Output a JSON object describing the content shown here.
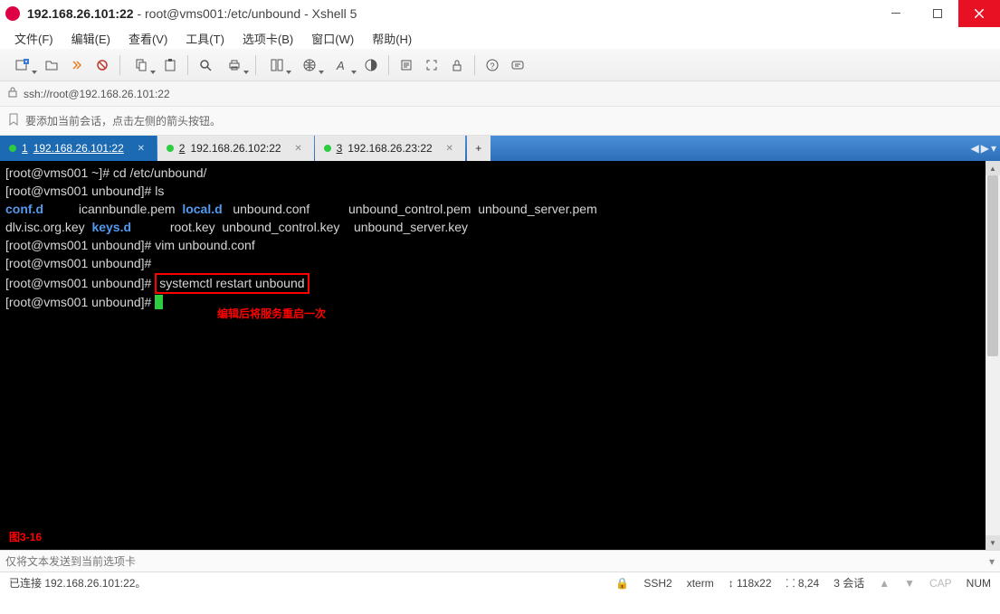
{
  "window": {
    "host": "192.168.26.101:22",
    "title_rest": " - root@vms001:/etc/unbound - Xshell 5"
  },
  "menu": [
    "文件(F)",
    "编辑(E)",
    "查看(V)",
    "工具(T)",
    "选项卡(B)",
    "窗口(W)",
    "帮助(H)"
  ],
  "address": {
    "url": "ssh://root@192.168.26.101:22"
  },
  "hint": "要添加当前会话，点击左侧的箭头按钮。",
  "tabs": [
    {
      "index": "1",
      "label": "192.168.26.101:22",
      "active": true
    },
    {
      "index": "2",
      "label": "192.168.26.102:22",
      "active": false
    },
    {
      "index": "3",
      "label": "192.168.26.23:22",
      "active": false
    }
  ],
  "terminal": {
    "l1_prompt": "[root@vms001 ~]#",
    "l1_cmd": " cd /etc/unbound/",
    "l2_prompt": "[root@vms001 unbound]#",
    "l2_cmd": " ls",
    "dir_conf": "conf.d",
    "l3a": "          icannbundle.pem  ",
    "dir_local": "local.d",
    "l3b": "   unbound.conf           unbound_control.pem  unbound_server.pem",
    "l4a": "dlv.isc.org.key  ",
    "dir_keys": "keys.d",
    "l4b": "           root.key  unbound_control.key    unbound_server.key",
    "l5_prompt": "[root@vms001 unbound]#",
    "l5_cmd": " vim unbound.conf",
    "l6_prompt": "[root@vms001 unbound]#",
    "l7_prompt": "[root@vms001 unbound]#",
    "l7_sp": " ",
    "l7_hl": "systemctl restart unbound",
    "l8_prompt": "[root@vms001 unbound]#",
    "l8_sp": " ",
    "annotation_restart": "编辑后将服务重启一次",
    "annotation_fig": "图3-16"
  },
  "sendbox": {
    "placeholder": "仅将文本发送到当前选项卡"
  },
  "status": {
    "left": "已连接 192.168.26.101:22。",
    "ssh": "SSH2",
    "term": "xterm",
    "size": "118x22",
    "cursor": "8,24",
    "sessions": "3 会话",
    "cap": "CAP",
    "num": "NUM"
  }
}
